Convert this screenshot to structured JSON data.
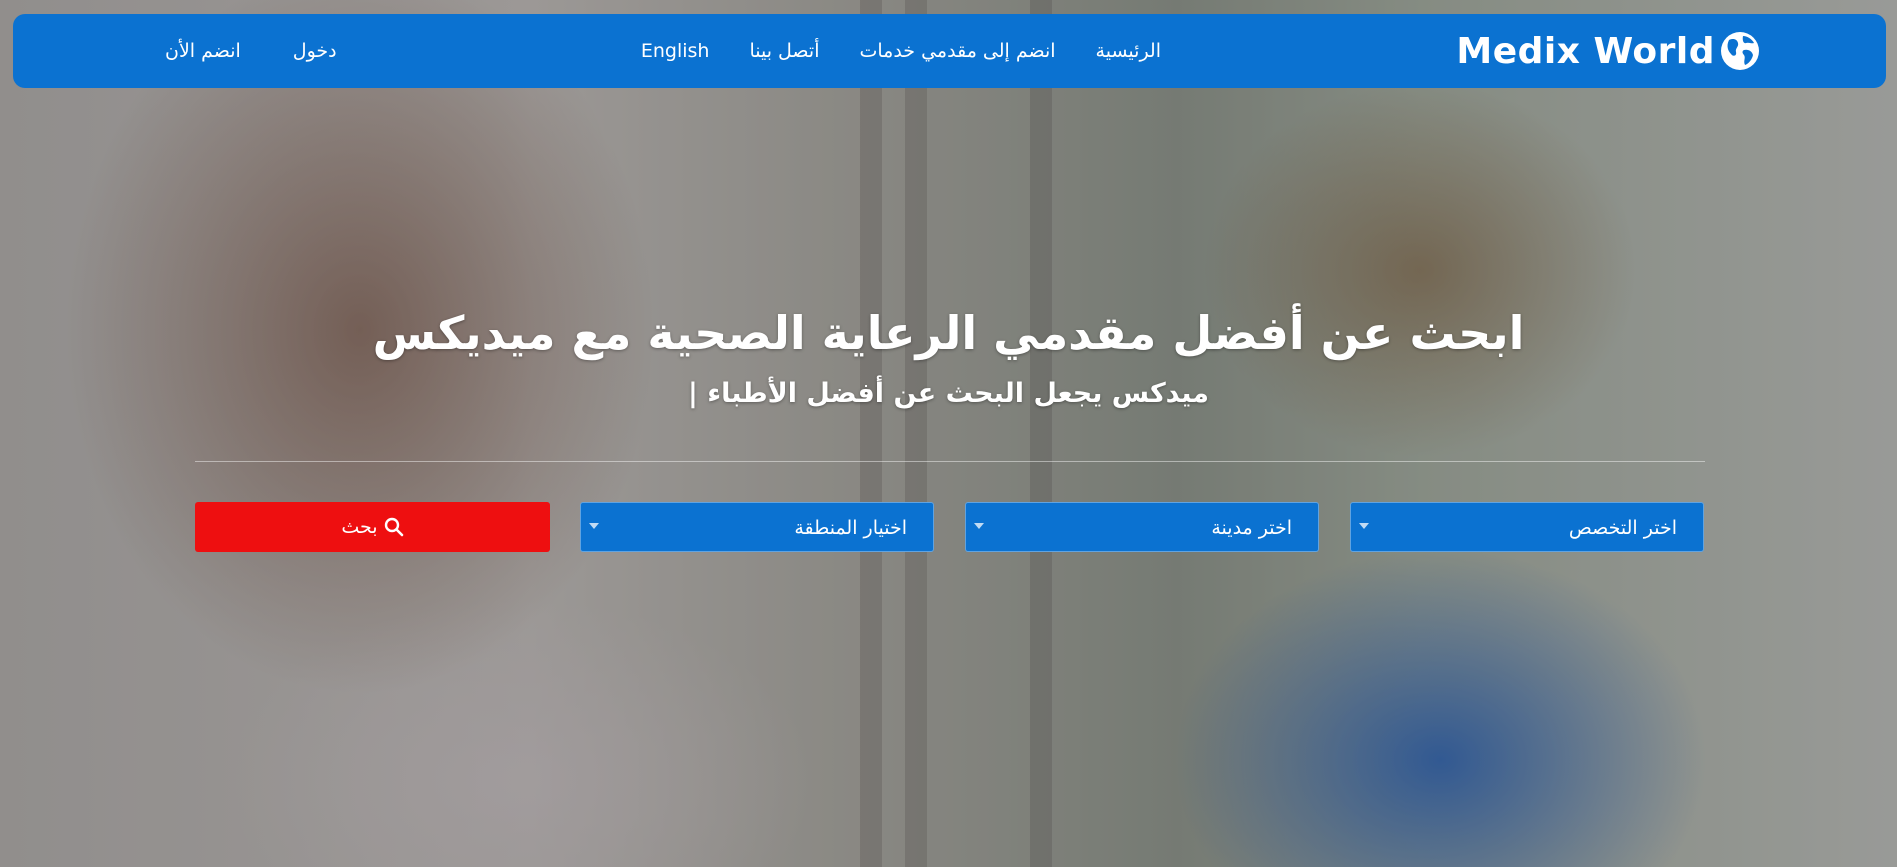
{
  "brand": {
    "name": "Medix World",
    "color": "#0b72d1"
  },
  "nav": {
    "links": [
      {
        "label": "الرئيسية"
      },
      {
        "label": "انضم إلى مقدمي خدمات"
      },
      {
        "label": "أتصل بينا"
      },
      {
        "label": "English"
      }
    ],
    "auth": {
      "login": "دخول",
      "join_now": "انضم الأن"
    }
  },
  "hero": {
    "title": "ابحث عن أفضل مقدمي الرعاية الصحية مع ميديكس",
    "subtitle": "ميدكس يجعل البحث عن أفضل الأطباء |"
  },
  "search": {
    "specialty": "اختر التخصص",
    "city": "اختر مدينة",
    "region": "اختيار المنطقة",
    "button": "بحث",
    "button_icon": "search-icon",
    "button_color": "#ee0f10"
  }
}
